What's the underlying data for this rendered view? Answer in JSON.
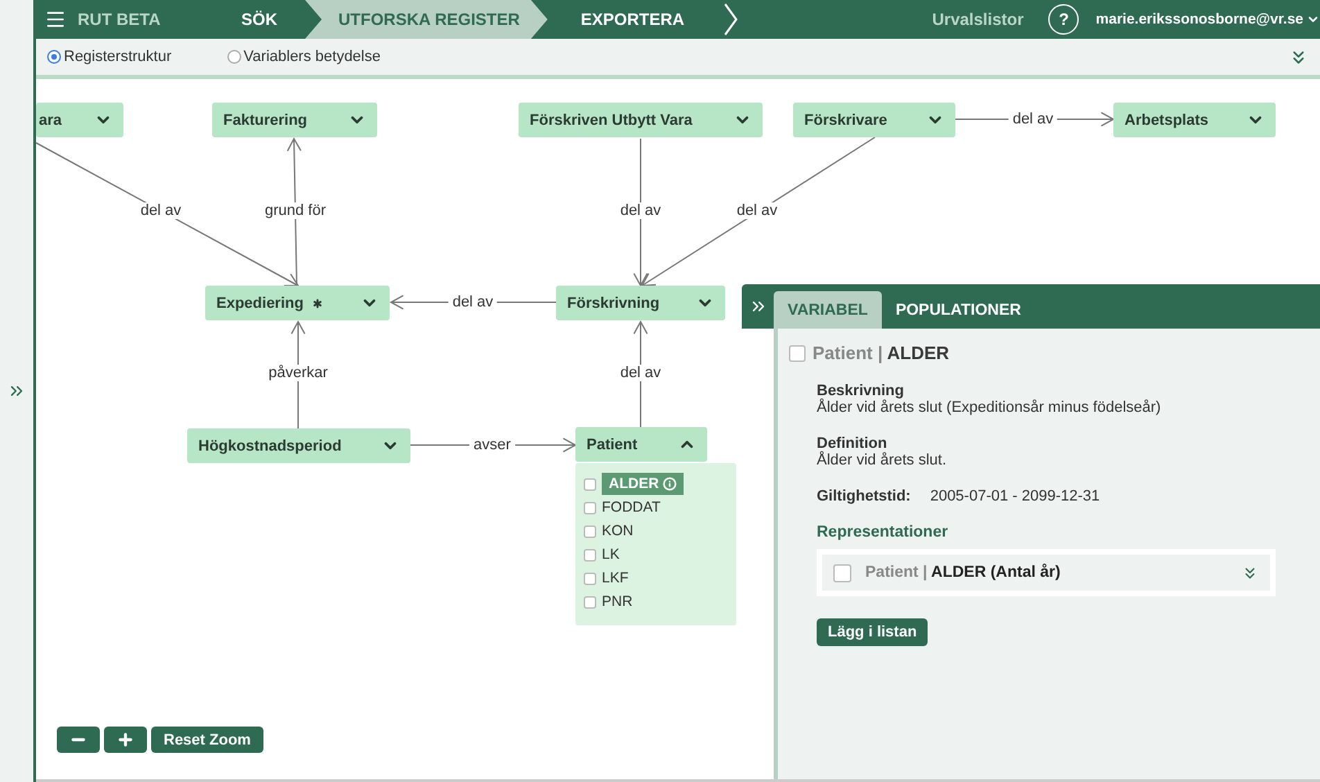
{
  "app": {
    "title": "RUT BETA"
  },
  "nav": {
    "steps": [
      {
        "label": "SÖK",
        "selected": false
      },
      {
        "label": "UTFORSKA REGISTER",
        "selected": true
      },
      {
        "label": "EXPORTERA",
        "selected": false
      }
    ],
    "lists_link": "Urvalslistor",
    "help": "?",
    "user": "marie.erikssonosborne@vr.se"
  },
  "view_options": [
    {
      "label": "Registerstruktur",
      "selected": true
    },
    {
      "label": "Variablers betydelse",
      "selected": false
    }
  ],
  "diagram": {
    "nodes": [
      {
        "label": "ara",
        "expanded": false,
        "starred": false
      },
      {
        "label": "Fakturering",
        "expanded": false,
        "starred": false
      },
      {
        "label": "Förskriven Utbytt Vara",
        "expanded": false,
        "starred": false
      },
      {
        "label": "Förskrivare",
        "expanded": false,
        "starred": false
      },
      {
        "label": "Arbetsplats",
        "expanded": false,
        "starred": false
      },
      {
        "label": "Expediering",
        "expanded": false,
        "starred": true
      },
      {
        "label": "Förskrivning",
        "expanded": false,
        "starred": false
      },
      {
        "label": "Högkostnadsperiod",
        "expanded": false,
        "starred": false
      },
      {
        "label": "Patient",
        "expanded": true,
        "starred": false,
        "variables": [
          {
            "name": "ALDER",
            "selected": true,
            "checked": false
          },
          {
            "name": "FODDAT",
            "selected": false,
            "checked": false
          },
          {
            "name": "KON",
            "selected": false,
            "checked": false
          },
          {
            "name": "LK",
            "selected": false,
            "checked": false
          },
          {
            "name": "LKF",
            "selected": false,
            "checked": false
          },
          {
            "name": "PNR",
            "selected": false,
            "checked": false
          }
        ]
      }
    ],
    "edges": [
      {
        "label": "del av"
      },
      {
        "label": "grund för"
      },
      {
        "label": "del av"
      },
      {
        "label": "del av"
      },
      {
        "label": "del av"
      },
      {
        "label": "del av"
      },
      {
        "label": "påverkar"
      },
      {
        "label": "del av"
      },
      {
        "label": "avser"
      }
    ]
  },
  "zoom_controls": {
    "reset": "Reset Zoom"
  },
  "detail_panel": {
    "tabs": [
      {
        "label": "VARIABEL",
        "selected": true
      },
      {
        "label": "POPULATIONER",
        "selected": false
      }
    ],
    "checked": false,
    "title_table": "Patient |",
    "title_variable": "ALDER",
    "fields": [
      {
        "label": "Beskrivning",
        "value": "Ålder vid årets slut (Expeditionsår minus födelseår)",
        "kind": "block"
      },
      {
        "label": "Definition",
        "value": "Ålder vid årets slut.",
        "kind": "block"
      },
      {
        "label": "Giltighetstid:",
        "value": "2005-07-01 - 2099-12-31",
        "kind": "inline"
      }
    ],
    "representations_heading": "Representationer",
    "representations": [
      {
        "table": "Patient |",
        "name": "ALDER (Antal år)",
        "checked": false
      }
    ],
    "add_button": "Lägg i listan"
  }
}
